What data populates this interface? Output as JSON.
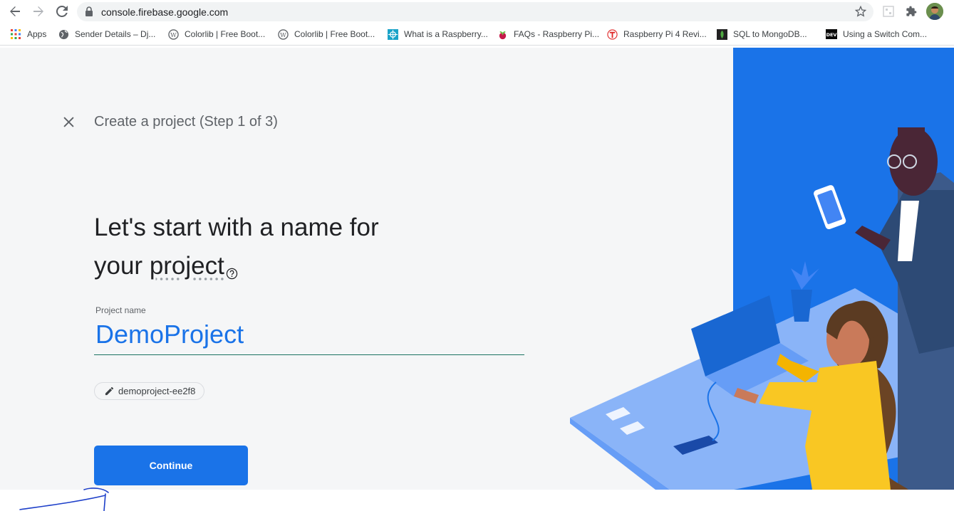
{
  "browser": {
    "url": "console.firebase.google.com",
    "bookmarks": [
      {
        "label": "Apps",
        "icon": "apps-grid-icon"
      },
      {
        "label": "Sender Details – Dj...",
        "icon": "globe-icon"
      },
      {
        "label": "Colorlib | Free Boot...",
        "icon": "wordpress-icon"
      },
      {
        "label": "Colorlib | Free Boot...",
        "icon": "wordpress-icon"
      },
      {
        "label": "What is a Raspberry...",
        "icon": "raspberry-site-icon"
      },
      {
        "label": "FAQs - Raspberry Pi...",
        "icon": "raspberry-pi-icon"
      },
      {
        "label": "Raspberry Pi 4 Revi...",
        "icon": "tom-hardware-icon"
      },
      {
        "label": "SQL to MongoDB...",
        "icon": "mongodb-icon"
      },
      {
        "label": "Using a Switch Com...",
        "icon": "dev-icon"
      }
    ]
  },
  "wizard": {
    "step_title": "Create a project (Step 1 of 3)",
    "heading_line1": "Let's start with a name for",
    "heading_line2_prefix": "your ",
    "heading_line2_term": "project",
    "field_label": "Project name",
    "field_value": "DemoProject",
    "project_id": "demoproject-ee2f8",
    "continue_label": "Continue"
  },
  "colors": {
    "accent": "#1a73e8",
    "illustration_bg": "#1a73e8",
    "page_bg": "#f5f6f7"
  }
}
